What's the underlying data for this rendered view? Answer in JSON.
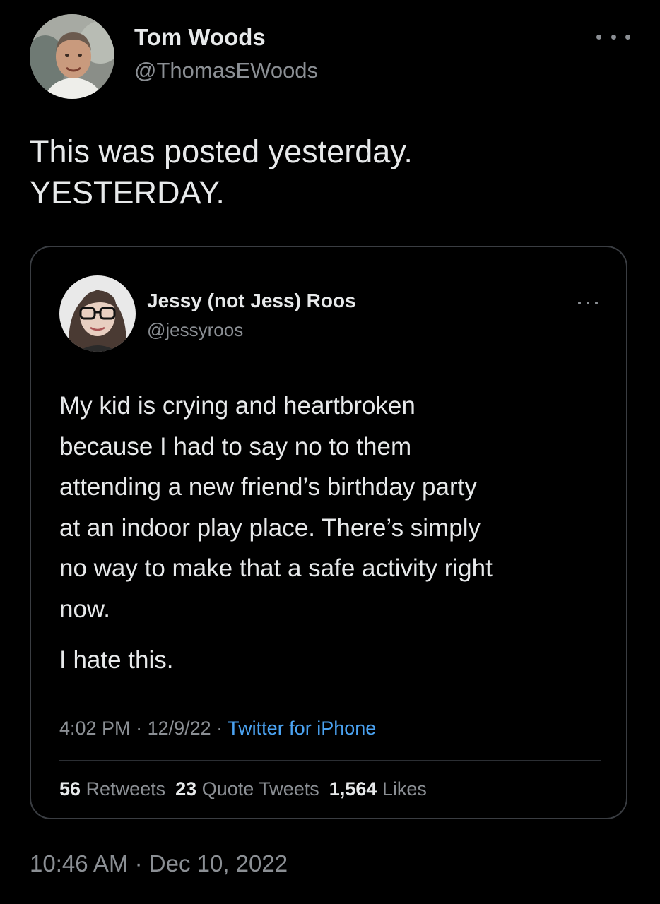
{
  "tweet": {
    "author": {
      "name": "Tom Woods",
      "handle": "@ThomasEWoods"
    },
    "text_lines": [
      "This was posted yesterday.",
      "YESTERDAY."
    ],
    "timestamp": "10:46 AM · Dec 10, 2022",
    "more_icon": "more-horizontal-icon"
  },
  "quoted_tweet": {
    "author": {
      "name": "Jessy (not Jess) Roos",
      "handle": "@jessyroos"
    },
    "text_lines": [
      "My kid is crying and heartbroken",
      "because I had to say no to them",
      "attending a new friend’s birthday party",
      "at an indoor play place. There’s simply",
      "no way to make that a safe activity right",
      "now."
    ],
    "text_line_2": "I hate this.",
    "time": "4:02 PM",
    "date": "12/9/22",
    "source": "Twitter for iPhone",
    "separator": " · ",
    "stats": {
      "retweets_count": "56",
      "retweets_label": "Retweets",
      "quotes_count": "23",
      "quotes_label": "Quote Tweets",
      "likes_count": "1,564",
      "likes_label": "Likes"
    },
    "more_icon": "more-horizontal-icon"
  },
  "colors": {
    "background": "#000000",
    "primary_text": "#e7e9ea",
    "secondary_text": "#8b8f94",
    "link": "#4ba3f2",
    "border": "#3a3d42"
  }
}
